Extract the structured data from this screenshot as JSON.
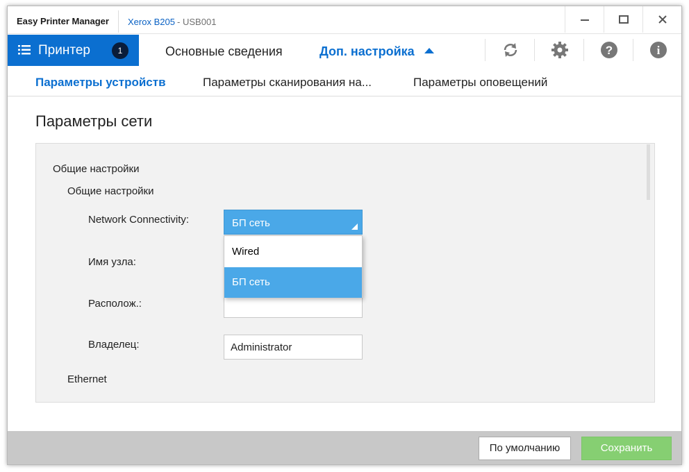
{
  "app": {
    "title": "Easy Printer Manager",
    "device_name": "Xerox B205",
    "device_dash": "-",
    "device_port": "USB001"
  },
  "window_controls": {
    "minimize_icon": "minimize-icon",
    "maximize_icon": "maximize-icon",
    "close_icon": "close-icon"
  },
  "nav": {
    "printer_label": "Принтер",
    "printer_badge": "1",
    "basic_label": "Основные сведения",
    "advanced_label": "Доп. настройка",
    "tools": [
      "refresh-icon",
      "gear-icon",
      "help-icon",
      "info-icon"
    ]
  },
  "subnav": {
    "tabs": [
      {
        "label": "Параметры устройств",
        "active": true
      },
      {
        "label": "Параметры сканирования на...",
        "active": false
      },
      {
        "label": "Параметры оповещений",
        "active": false
      }
    ]
  },
  "content": {
    "page_title": "Параметры сети",
    "section_general": "Общие настройки",
    "subsection_general": "Общие настройки",
    "fields": {
      "network_label": "Network Connectivity:",
      "network_value": "БП сеть",
      "host_label": "Имя узла:",
      "location_label": "Располож.:",
      "owner_label": "Владелец:",
      "owner_value": "Administrator"
    },
    "dropdown_options": [
      {
        "label": "Wired",
        "selected": false
      },
      {
        "label": "БП сеть",
        "selected": true
      }
    ],
    "section_ethernet": "Ethernet"
  },
  "footer": {
    "default_label": "По умолчанию",
    "save_label": "Сохранить"
  },
  "colors": {
    "accent": "#0b6fd0",
    "select_bg": "#4aa8e8",
    "save_bg": "#86cf72",
    "footer_bg": "#c8c8c8"
  }
}
